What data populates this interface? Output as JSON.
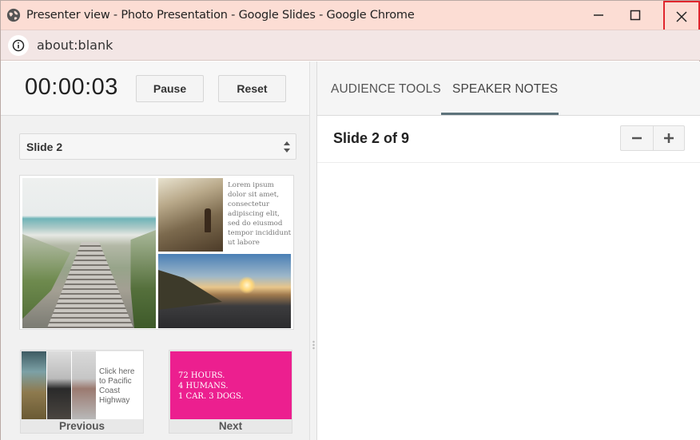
{
  "window": {
    "title": "Presenter view - Photo Presentation - Google Slides - Google Chrome",
    "url": "about:blank",
    "controls": {
      "minimize": "minimize-icon",
      "maximize": "maximize-icon",
      "close": "close-icon"
    },
    "close_highlight_color": "#e0262d"
  },
  "timer": {
    "elapsed": "00:00:03",
    "pause_label": "Pause",
    "reset_label": "Reset"
  },
  "slide_selector": {
    "selected": "Slide 2"
  },
  "current_slide": {
    "body_text": "Lorem ipsum dolor sit amet, consectetur adipiscing elit, sed do eiusmod tempor incididunt ut labore"
  },
  "previous_slide": {
    "caption": "Click here to Pacific Coast Highway",
    "label": "Previous"
  },
  "next_slide": {
    "line1": "72 HOURS.",
    "line2": "4 HUMANS.",
    "line3": "1 CAR. 3 DOGS.",
    "background_color": "#ec1f8f",
    "label": "Next"
  },
  "tabs": [
    {
      "label": "AUDIENCE TOOLS",
      "active": false
    },
    {
      "label": "SPEAKER NOTES",
      "active": true
    }
  ],
  "notes": {
    "position": "Slide 2 of 9",
    "zoom_out": "−",
    "zoom_in": "+",
    "content": ""
  }
}
